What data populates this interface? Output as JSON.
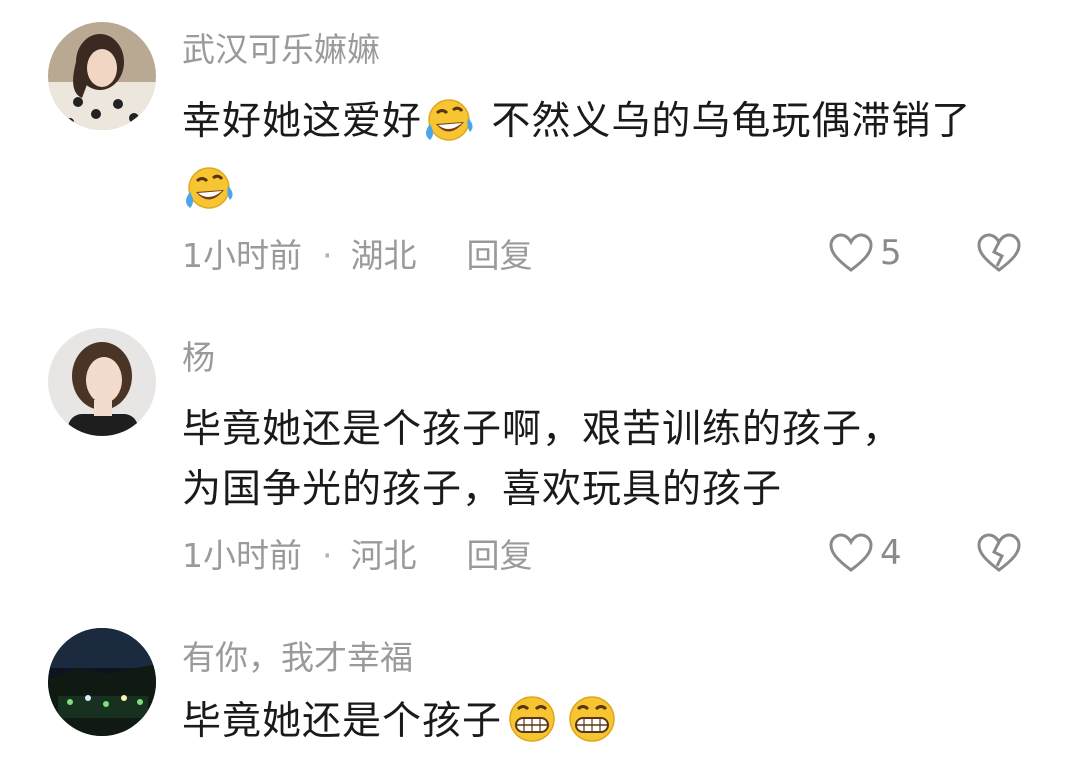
{
  "comments": [
    {
      "username": "武汉可乐嫲嫲",
      "text_part1": "幸好她这爱好",
      "text_part2": " 不然义乌的乌龟玩偶滞销了",
      "time": "1小时前",
      "location": "湖北",
      "reply_label": "回复",
      "likes": "5"
    },
    {
      "username": "杨",
      "text_line1": "毕竟她还是个孩子啊，艰苦训练的孩子，",
      "text_line2": "为国争光的孩子，喜欢玩具的孩子",
      "time": "1小时前",
      "location": "河北",
      "reply_label": "回复",
      "likes": "4"
    },
    {
      "username": "有你，我才幸福",
      "text": "毕竟她还是个孩子"
    }
  ],
  "separator": "·",
  "icons": {
    "like": "heart-outline-icon",
    "dislike": "broken-heart-icon",
    "emoji_laugh_cry": "rolling-laugh-emoji",
    "emoji_grin": "grinning-emoji"
  },
  "colors": {
    "username": "#9a9a9a",
    "text": "#1a1a1a",
    "meta": "#9a9a9a",
    "emoji_yellow": "#f7c531"
  }
}
